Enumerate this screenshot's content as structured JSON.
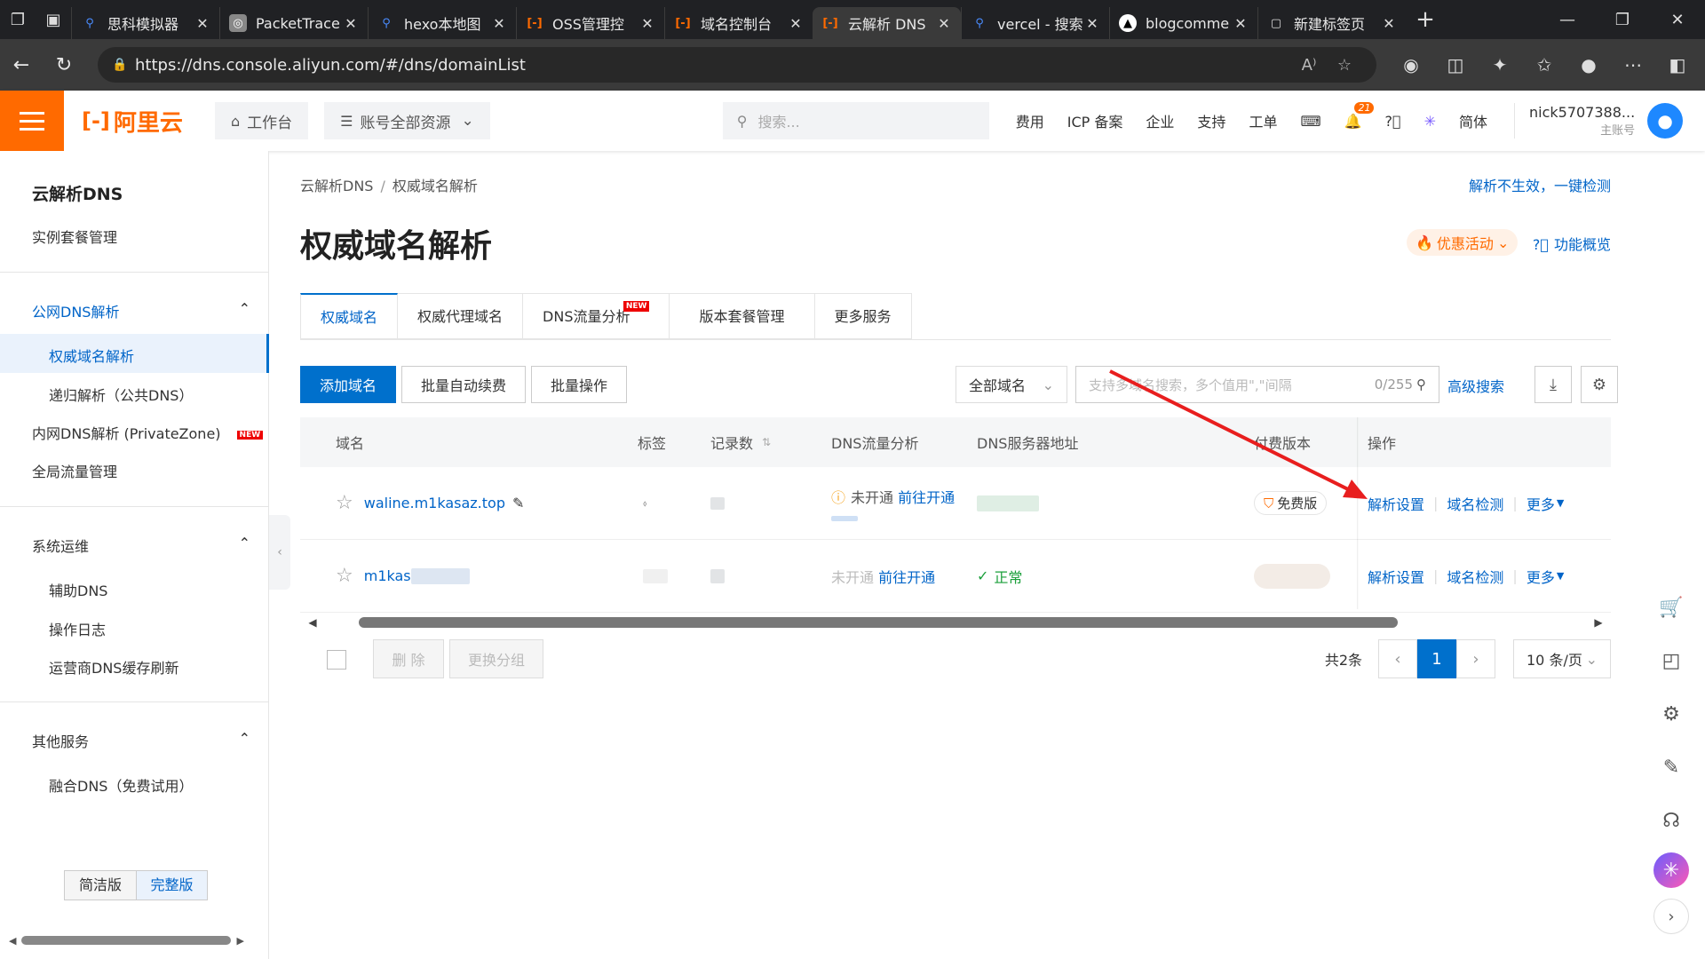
{
  "browser": {
    "tabs": [
      {
        "icon": "search-icon",
        "title": "思科模拟器",
        "active": false
      },
      {
        "icon": "packettracer-icon",
        "title": "PacketTrace",
        "active": false
      },
      {
        "icon": "search-icon",
        "title": "hexo本地图",
        "active": false
      },
      {
        "icon": "aliyun-icon",
        "title": "OSS管理控",
        "active": false
      },
      {
        "icon": "aliyun-icon",
        "title": "域名控制台",
        "active": false
      },
      {
        "icon": "aliyun-icon",
        "title": "云解析 DNS",
        "active": true
      },
      {
        "icon": "search-icon",
        "title": "vercel - 搜索",
        "active": false
      },
      {
        "icon": "vercel-icon",
        "title": "blogcomme",
        "active": false
      },
      {
        "icon": "newtab-icon",
        "title": "新建标签页",
        "active": false
      }
    ],
    "url": "https://dns.console.aliyun.com/#/dns/domainList"
  },
  "topnav": {
    "logo": "阿里云",
    "workbench": "工作台",
    "resources": "账号全部资源",
    "search_placeholder": "搜索...",
    "links": [
      "费用",
      "ICP 备案",
      "企业",
      "支持",
      "工单"
    ],
    "bell_count": "21",
    "lang": "简体",
    "username": "nick5707388...",
    "role": "主账号"
  },
  "sidebar": {
    "title": "云解析DNS",
    "instance": "实例套餐管理",
    "group_public": "公网DNS解析",
    "auth_dns": "权威域名解析",
    "recursive": "递归解析（公共DNS）",
    "private_zone": "内网DNS解析 (PrivateZone)",
    "private_new": "NEW",
    "gtm": "全局流量管理",
    "group_ops": "系统运维",
    "aux_dns": "辅助DNS",
    "oplog": "操作日志",
    "cache": "运营商DNS缓存刷新",
    "group_other": "其他服务",
    "fusion": "融合DNS（免费试用）",
    "ver_simple": "简洁版",
    "ver_full": "完整版"
  },
  "main": {
    "breadcrumb_root": "云解析DNS",
    "breadcrumb_current": "权威域名解析",
    "check_link": "解析不生效，一键检测",
    "title": "权威域名解析",
    "promo": "优惠活动",
    "feature": "功能概览",
    "tabs": [
      "权威域名",
      "权威代理域名",
      "DNS流量分析",
      "版本套餐管理",
      "更多服务"
    ],
    "tab_new": "NEW",
    "btn_add": "添加域名",
    "btn_renew": "批量自动续费",
    "btn_batch": "批量操作",
    "select_all_domains": "全部域名",
    "search_placeholder": "支持多域名搜索，多个值用\",\"间隔",
    "search_count": "0/255",
    "adv_search": "高级搜索",
    "columns": [
      "域名",
      "标签",
      "记录数",
      "DNS流量分析",
      "DNS服务器地址",
      "付费版本",
      "操作"
    ],
    "rows": [
      {
        "domain": "waline.m1kasaz.top",
        "dns_traffic": "未开通",
        "dns_traffic_link": "前往开通",
        "edition": "免费版",
        "op1": "解析设置",
        "op2": "域名检测",
        "op3": "更多"
      },
      {
        "domain": "m1kas",
        "dns_traffic": "未开通",
        "dns_traffic_link": "前往开通",
        "dns_status": "正常",
        "op1": "解析设置",
        "op2": "域名检测",
        "op3": "更多"
      }
    ],
    "btn_delete": "删 除",
    "btn_group": "更换分组",
    "total": "共2条",
    "page": "1",
    "page_size": "10 条/页"
  }
}
